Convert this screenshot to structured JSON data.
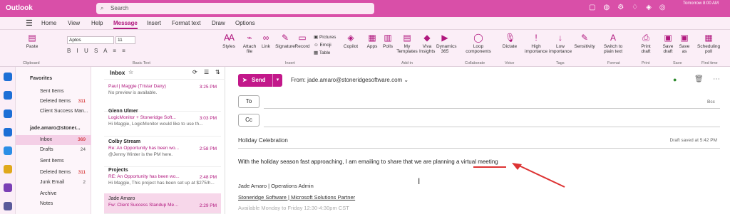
{
  "app": {
    "name": "Outlook"
  },
  "search": {
    "placeholder": "Search"
  },
  "meeting": {
    "line1": "Tomorrow 8:00 AM",
    "line2": "Find time"
  },
  "tabs": [
    "Home",
    "View",
    "Help",
    "Message",
    "Insert",
    "Format text",
    "Draw",
    "Options"
  ],
  "ribbon": {
    "paste": "Paste",
    "clipboard": "Clipboard",
    "font": "Aptos",
    "size": "11",
    "basic_text": "Basic Text",
    "styles": "Styles",
    "attach": "Attach file",
    "link": "Link",
    "signature": "Signature",
    "record": "Record",
    "pictures": "Pictures",
    "emoji": "Emoji",
    "table": "Table",
    "insert": "Insert",
    "copilot": "Copilot",
    "apps": "Apps",
    "polls": "Polls",
    "my_templates": "My Templates",
    "viva": "Viva Insights",
    "dynamics": "Dynamics 365",
    "addin": "Add-in",
    "loop": "Loop components",
    "collaborate": "Collaborate",
    "dictate": "Dictate",
    "voice": "Voice",
    "high": "High importance",
    "low": "Low importance",
    "sensitivity": "Sensitivity",
    "tags": "Tags",
    "plain": "Switch to plain text",
    "format": "Format",
    "print_draft": "Print draft",
    "print": "Print",
    "save_draft": "Save draft",
    "save_as": "Save as",
    "save": "Save",
    "sched": "Scheduling poll",
    "find_time": "Find time"
  },
  "folders": {
    "favorites": "Favorites",
    "account": "jade.amaro@stoner...",
    "fav": [
      {
        "label": "Sent Items",
        "count": ""
      },
      {
        "label": "Deleted Items",
        "count": "311"
      },
      {
        "label": "Client Success Man...",
        "count": ""
      }
    ],
    "acct": [
      {
        "label": "Inbox",
        "count": "369"
      },
      {
        "label": "Drafts",
        "count": "24"
      },
      {
        "label": "Sent Items",
        "count": ""
      },
      {
        "label": "Deleted Items",
        "count": "311"
      },
      {
        "label": "Junk Email",
        "count": "2"
      },
      {
        "label": "Archive",
        "count": ""
      },
      {
        "label": "Notes",
        "count": ""
      }
    ]
  },
  "maillist": {
    "title": "Inbox",
    "messages": [
      {
        "from": "Paul | Maggie (Tristar Dairy)",
        "subject": "",
        "preview": "No preview is available.",
        "time": "3:25 PM"
      },
      {
        "from": "Glenn Ulmer",
        "subject": "LogicMonitor + Stoneridge Soft...",
        "preview": "Hi Maggie, LogicMonitor would like to use th...",
        "time": "3:03 PM"
      },
      {
        "from": "Colby Stream",
        "subject": "Re: An Opportunity has been wo...",
        "preview": "@Jenny Winter is the PM here.",
        "time": "2:58 PM"
      },
      {
        "from": "Projects",
        "subject": "RE: An Opportunity has been wo...",
        "preview": "Hi Maggie, This project has been set up at $275/h...",
        "time": "2:48 PM"
      },
      {
        "from": "Jade Amaro",
        "subject": "Fw: Client Success Standup Meeti...",
        "preview": "",
        "time": "2:29 PM"
      }
    ]
  },
  "compose": {
    "send": "Send",
    "from": "From: jade.amaro@stoneridgesoftware.com",
    "to": "To",
    "cc": "Cc",
    "bcc": "Bcc",
    "subject": "Holiday Celebration",
    "draft_saved": "Draft saved at 5:42 PM",
    "body": "With the holiday season fast approaching, I am emailing to share that we are planning a virtual meeting",
    "sig_name": "Jade Amaro | Operations Admin",
    "sig_company": "Stoneridge Software | Microsoft Solutions Partner",
    "sig_avail": "Available Monday to Friday 12:30-4:30pm CST"
  },
  "colors": {
    "accent": "#c2188a",
    "titlebar": "#d94fa8",
    "annotation": "#d33"
  }
}
